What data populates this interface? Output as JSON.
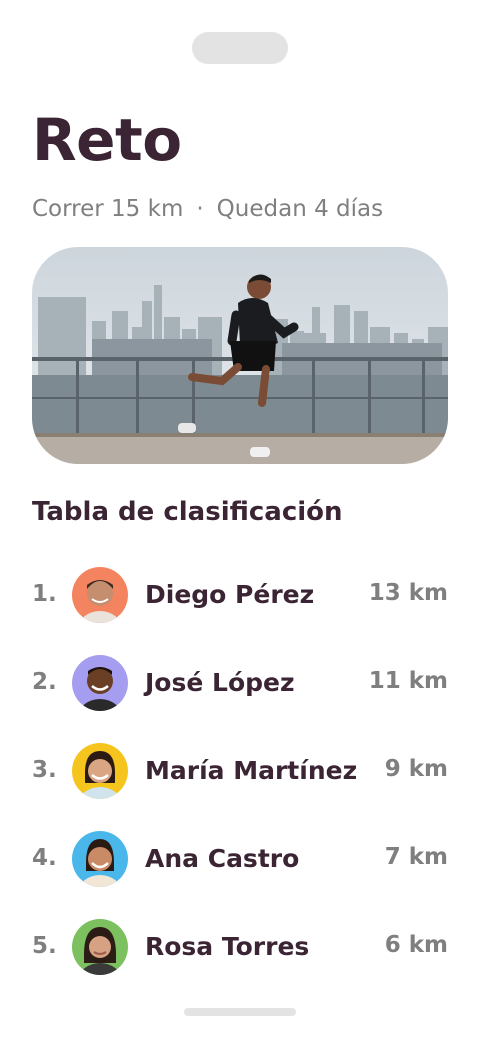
{
  "header": {
    "title": "Reto",
    "goal": "Correr 15 km",
    "separator": "·",
    "remaining": "Quedan 4 días"
  },
  "hero": {
    "image": "runner-city-skyline-photo"
  },
  "leaderboard": {
    "title": "Tabla de clasificación",
    "entries": [
      {
        "rank": "1.",
        "name": "Diego Pérez",
        "distance": "13 km",
        "avatar_bg": "#f4845f"
      },
      {
        "rank": "2.",
        "name": "José López",
        "distance": "11 km",
        "avatar_bg": "#a59ef0"
      },
      {
        "rank": "3.",
        "name": "María Martínez",
        "distance": "9 km",
        "avatar_bg": "#f6c51d"
      },
      {
        "rank": "4.",
        "name": "Ana Castro",
        "distance": "7 km",
        "avatar_bg": "#49b7ea"
      },
      {
        "rank": "5.",
        "name": "Rosa Torres",
        "distance": "6 km",
        "avatar_bg": "#7cc05f"
      }
    ]
  },
  "colors": {
    "text": "#3b2433",
    "muted": "#7f7f7f",
    "indicator": "#e3e3e3"
  }
}
